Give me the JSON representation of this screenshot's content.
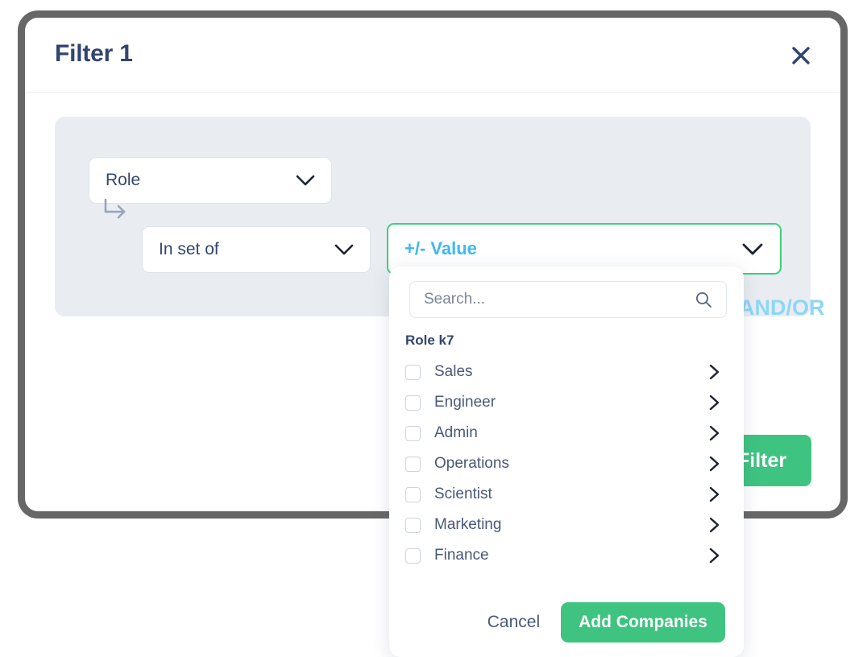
{
  "modal": {
    "title": "Filter 1",
    "close_icon": "close-x-icon"
  },
  "filter_row": {
    "attribute": {
      "value": "Role",
      "chevron_icon": "chevron-down-icon"
    },
    "branch_icon": "elbow-arrow-right-icon",
    "operator": {
      "value": "In set of",
      "chevron_icon": "chevron-down-icon"
    },
    "value_field": {
      "value": "+/- Value",
      "chevron_icon": "chevron-down-icon",
      "border_color": "#3fce7e",
      "text_color": "#3eb8ef"
    },
    "andor_label": "AND/OR"
  },
  "primary_action": {
    "label": "Filter",
    "color": "#3fc380"
  },
  "dropdown": {
    "search": {
      "value": "",
      "placeholder": "Search...",
      "icon": "search-magnifier-icon"
    },
    "group_header": "Role k7",
    "options": [
      {
        "label": "Sales",
        "checked": false,
        "chevron_icon": "chevron-right-icon"
      },
      {
        "label": "Engineer",
        "checked": false,
        "chevron_icon": "chevron-right-icon"
      },
      {
        "label": "Admin",
        "checked": false,
        "chevron_icon": "chevron-right-icon"
      },
      {
        "label": "Operations",
        "checked": false,
        "chevron_icon": "chevron-right-icon"
      },
      {
        "label": "Scientist",
        "checked": false,
        "chevron_icon": "chevron-right-icon"
      },
      {
        "label": "Marketing",
        "checked": false,
        "chevron_icon": "chevron-right-icon"
      },
      {
        "label": "Finance",
        "checked": false,
        "chevron_icon": "chevron-right-icon"
      }
    ],
    "footer": {
      "cancel_label": "Cancel",
      "add_label": "Add Companies",
      "add_color": "#3fc380"
    }
  }
}
